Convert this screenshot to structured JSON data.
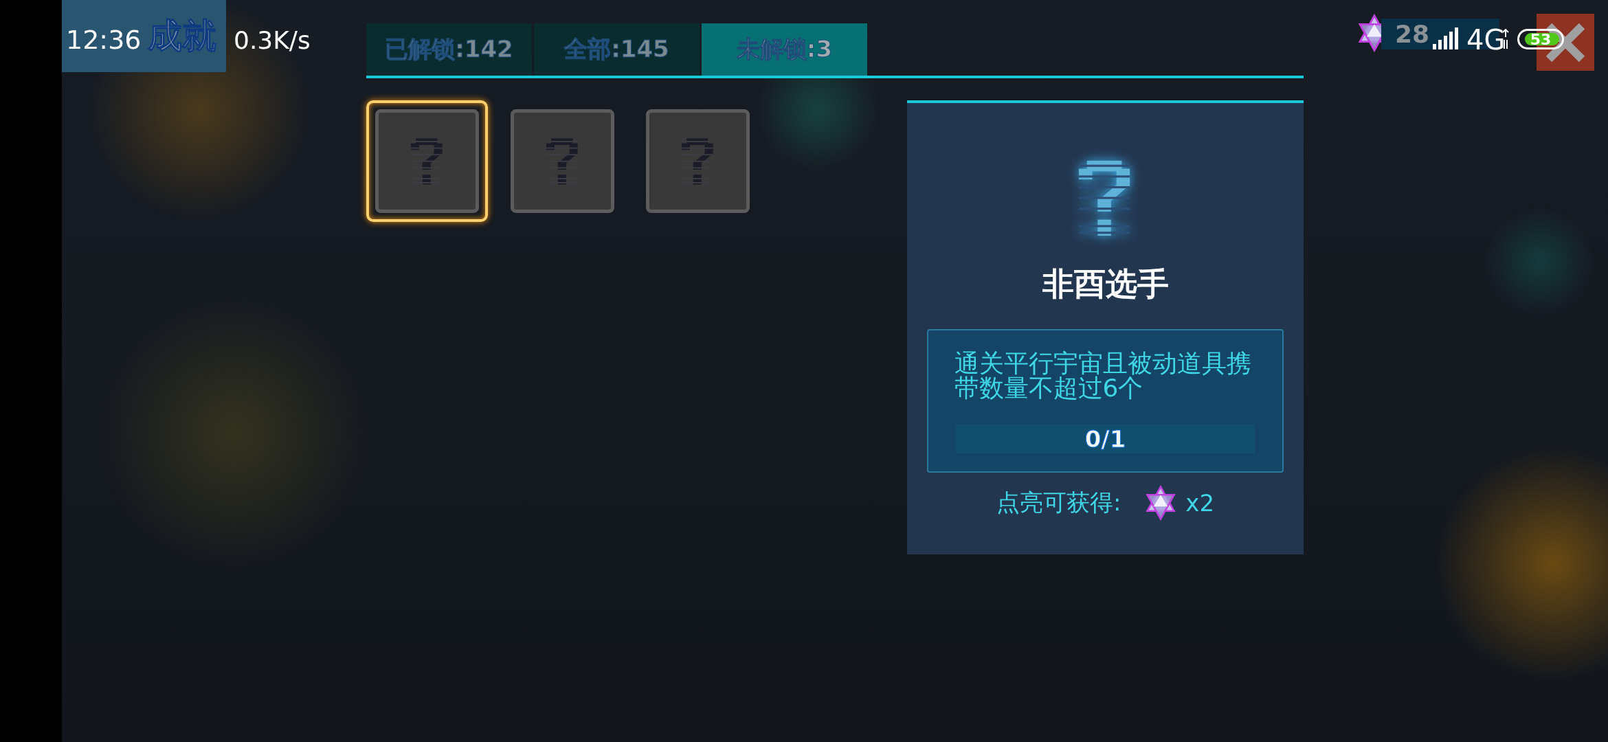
{
  "header": {
    "title": "成就"
  },
  "status_bar": {
    "time": "12:36",
    "speed": "0.3K/s",
    "network": "4G",
    "battery": "53"
  },
  "currency": {
    "count": "28"
  },
  "tabs": [
    {
      "label": "已解锁:142",
      "selected": false
    },
    {
      "label": "全部:145",
      "selected": false
    },
    {
      "label": "未解锁:3",
      "selected": true
    }
  ],
  "achievements": [
    {
      "selected": true
    },
    {
      "selected": false
    },
    {
      "selected": false
    }
  ],
  "detail": {
    "name": "非酉选手",
    "description": "通关平行宇宙且被动道具携带数量不超过6个",
    "progress": {
      "text": "0/1",
      "level": 0
    },
    "reward_label": "点亮可获得:",
    "reward_count": "x2"
  }
}
